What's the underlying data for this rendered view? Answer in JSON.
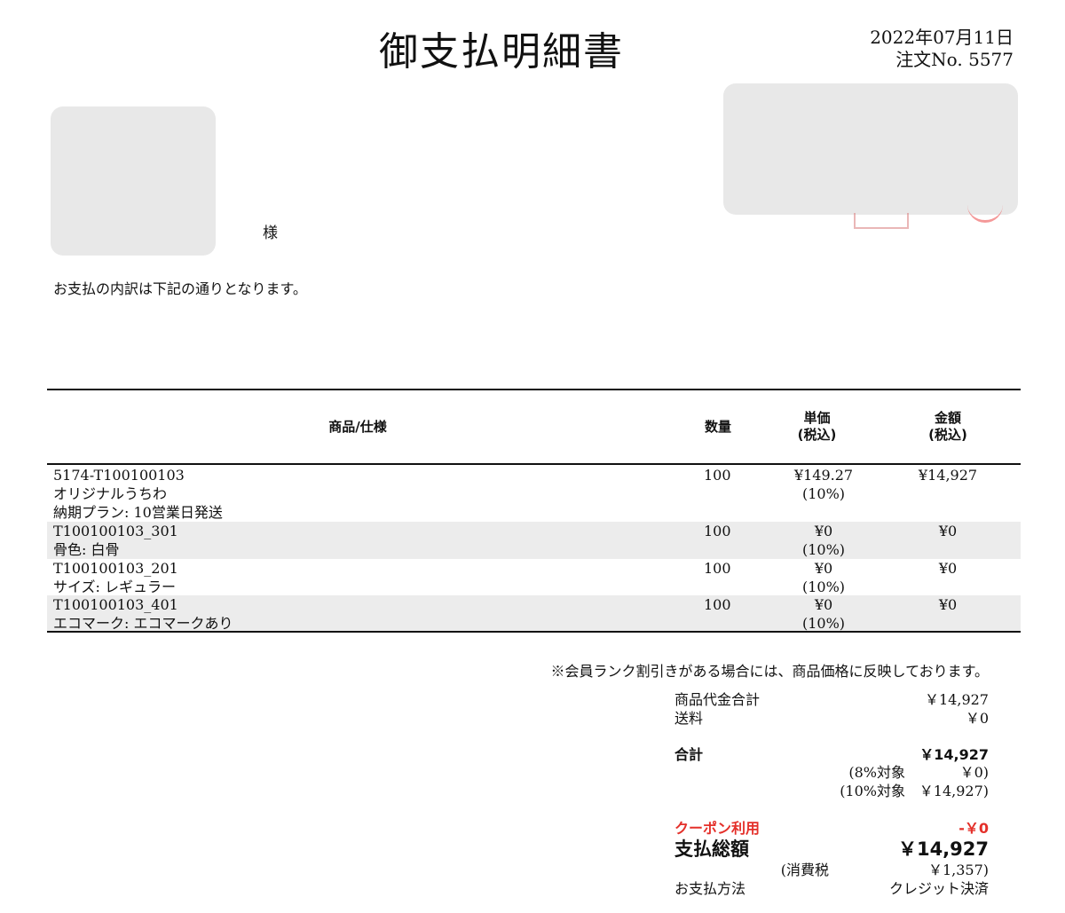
{
  "header": {
    "title": "御支払明細書",
    "date": "2022年07月11日",
    "order_no": "注文No. 5577"
  },
  "customer": {
    "honorific": "様"
  },
  "intro": "お支払の内訳は下記の通りとなります。",
  "table": {
    "headers": {
      "item": "商品/仕様",
      "qty": "数量",
      "price_line1": "単価",
      "price_line2": "(税込)",
      "amount_line1": "金額",
      "amount_line2": "(税込)"
    },
    "rows": [
      {
        "lines": [
          "5174-T100100103",
          "オリジナルうちわ",
          "納期プラン: 10営業日発送"
        ],
        "qty": "100",
        "price": "¥149.27",
        "tax": "(10%)",
        "amount": "¥14,927"
      },
      {
        "lines": [
          "T100100103_301",
          "骨色: 白骨"
        ],
        "qty": "100",
        "price": "¥0",
        "tax": "(10%)",
        "amount": "¥0"
      },
      {
        "lines": [
          "T100100103_201",
          "サイズ: レギュラー"
        ],
        "qty": "100",
        "price": "¥0",
        "tax": "(10%)",
        "amount": "¥0"
      },
      {
        "lines": [
          "T100100103_401",
          "エコマーク: エコマークあり"
        ],
        "qty": "100",
        "price": "¥0",
        "tax": "(10%)",
        "amount": "¥0"
      }
    ]
  },
  "note": "※会員ランク割引きがある場合には、商品価格に反映しております。",
  "summary": {
    "subtotal_label": "商品代金合計",
    "subtotal_value": "￥14,927",
    "shipping_label": "送料",
    "shipping_value": "￥0",
    "total_label": "合計",
    "total_value": "￥14,927",
    "tax8_label": "(8%対象",
    "tax8_value": "￥0)",
    "tax10_label": "(10%対象",
    "tax10_value": "￥14,927)",
    "coupon_label": "クーポン利用",
    "coupon_value": "-￥0",
    "grand_label": "支払総額",
    "grand_value": "￥14,927",
    "consumption_label": "(消費税",
    "consumption_value": "￥1,357)",
    "method_label": "お支払方法",
    "method_value": "クレジット決済"
  }
}
